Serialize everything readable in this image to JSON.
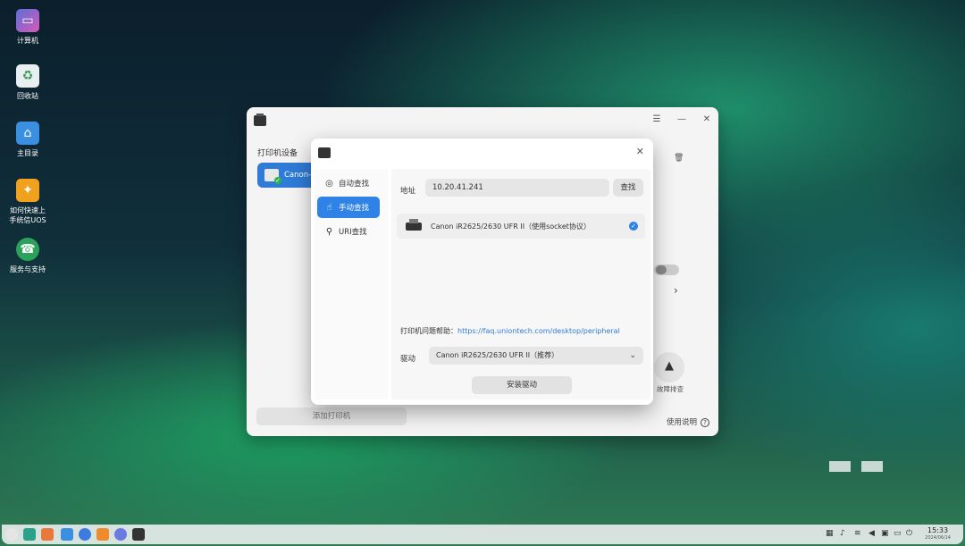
{
  "desktop": {
    "icons": [
      {
        "label": "计算机"
      },
      {
        "label": "回收站"
      },
      {
        "label": "主目录"
      },
      {
        "label": "如何快速上手统信UOS"
      },
      {
        "label": "服务与支持"
      }
    ]
  },
  "main_window": {
    "devices_header": "打印机设备",
    "device_name": "Canon-i",
    "add_printer": "添加打印机",
    "fault_label": "故障排查",
    "help_label": "使用说明"
  },
  "dialog": {
    "nav": [
      {
        "label": "自动查找"
      },
      {
        "label": "手动查找"
      },
      {
        "label": "URI查找"
      }
    ],
    "address_label": "地址",
    "address_value": "10.20.41.241",
    "search_button": "查找",
    "result_text": "Canon iR2625/2630 UFR II（使用socket协议）",
    "help_prefix": "打印机问题帮助：",
    "help_url": "https://faq.uniontech.com/desktop/peripheral",
    "driver_label": "驱动",
    "driver_value": "Canon iR2625/2630 UFR II（推荐）",
    "install_button": "安装驱动"
  },
  "taskbar": {
    "time": "15:33",
    "date": "2024/06/14"
  },
  "colors": {
    "accent": "#2f82e6",
    "link": "#2f7bd8"
  }
}
